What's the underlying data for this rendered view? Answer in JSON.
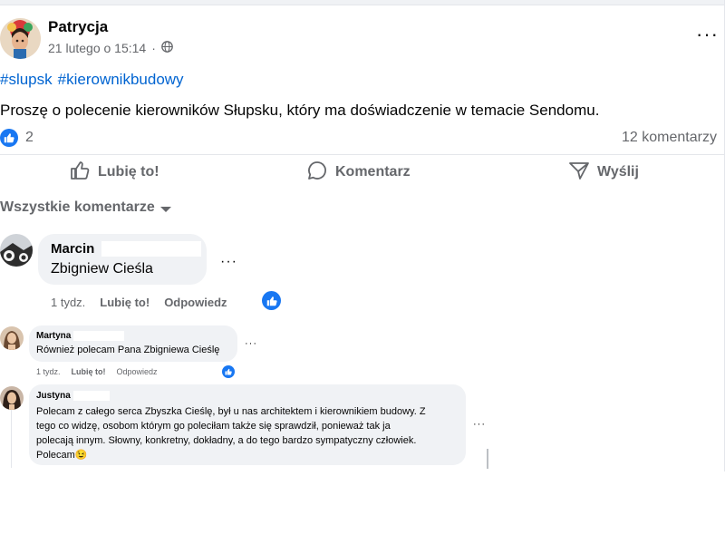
{
  "post": {
    "author": "Patrycja",
    "date": "21 lutego o 15:14",
    "date_sep": "·",
    "privacy_icon": "globe-icon",
    "hashtags": [
      "#slupsk",
      "#kierownikbudowy"
    ],
    "text": "Proszę o polecenie kierowników Słupsku, który ma doświadczenie w temacie Sendomu.",
    "reaction_count": "2",
    "comments_count": "12 komentarzy",
    "more_label": "···"
  },
  "actions": {
    "like": "Lubię to!",
    "comment": "Komentarz",
    "share": "Wyślij"
  },
  "comments_filter": "Wszystkie komentarze",
  "comments": [
    {
      "name": "Marcin",
      "text": "Zbigniew Cieśla",
      "time": "1 tydz.",
      "like": "Lubię to!",
      "reply": "Odpowiedz",
      "more": "···"
    },
    {
      "name": "Martyna",
      "text": "Również polecam Pana Zbigniewa Cieślę",
      "time": "1 tydz.",
      "like": "Lubię to!",
      "reply": "Odpowiedz",
      "more": "···"
    },
    {
      "name": "Justyna",
      "lines": [
        "Polecam z całego serca Zbyszka Cieślę, był u nas architektem i kierownikiem budowy. Z",
        "tego co widzę, osobom którym go poleciłam także się sprawdził, ponieważ tak ja",
        "polecają innym. Słowny, konkretny, dokładny, a do tego bardzo sympatyczny człowiek.",
        "Polecam"
      ],
      "emoji": "😉",
      "more": "···"
    }
  ],
  "colors": {
    "accent": "#1877f2",
    "link": "#0064d1",
    "bubble": "#f0f2f5",
    "secondary_text": "#65676b"
  }
}
